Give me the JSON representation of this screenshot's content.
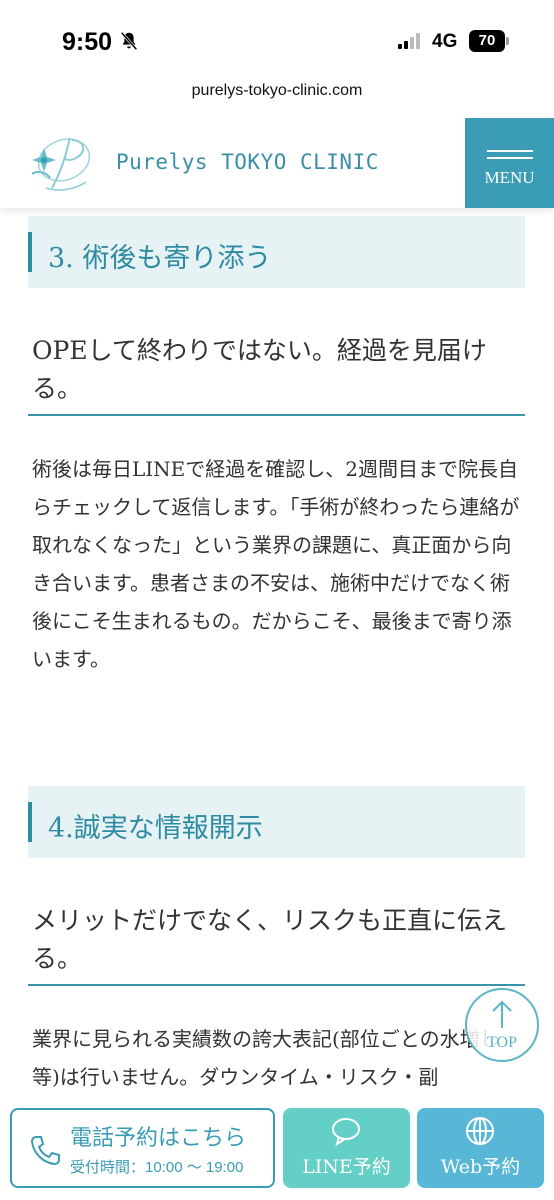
{
  "status_bar": {
    "time": "9:50",
    "network": "4G",
    "battery": "70"
  },
  "browser": {
    "url": "purelys-tokyo-clinic.com"
  },
  "header": {
    "site_name": "Purelys TOKYO CLINIC",
    "menu_label": "MENU"
  },
  "sections": [
    {
      "heading": "3. 術後も寄り添う",
      "subtitle": "OPEして終わりではない。経過を見届ける。",
      "body": "術後は毎日LINEで経過を確認し、2週間目まで院長自らチェックして返信します。「手術が終わったら連絡が取れなくなった」という業界の課題に、真正面から向き合います。患者さまの不安は、施術中だけでなく術後にこそ生まれるもの。だからこそ、最後まで寄り添います。"
    },
    {
      "heading": "4.誠実な情報開示",
      "subtitle": "メリットだけでなく、リスクも正直に伝える。",
      "body": "業界に見られる実績数の誇大表記(部位ごとの水増し等)は行いません。ダウンタイム・リスク・副"
    }
  ],
  "top_button": {
    "label": "TOP"
  },
  "bottom_bar": {
    "phone_label": "電話予約はこちら",
    "phone_hours": "受付時間：10:00 〜 19:00",
    "line_label": "LINE予約",
    "web_label": "Web予約"
  },
  "colors": {
    "accent": "#3a9cb5",
    "heading_bg": "#e6f2f4",
    "line_button": "#63cfc6",
    "web_button": "#58b6d6"
  }
}
